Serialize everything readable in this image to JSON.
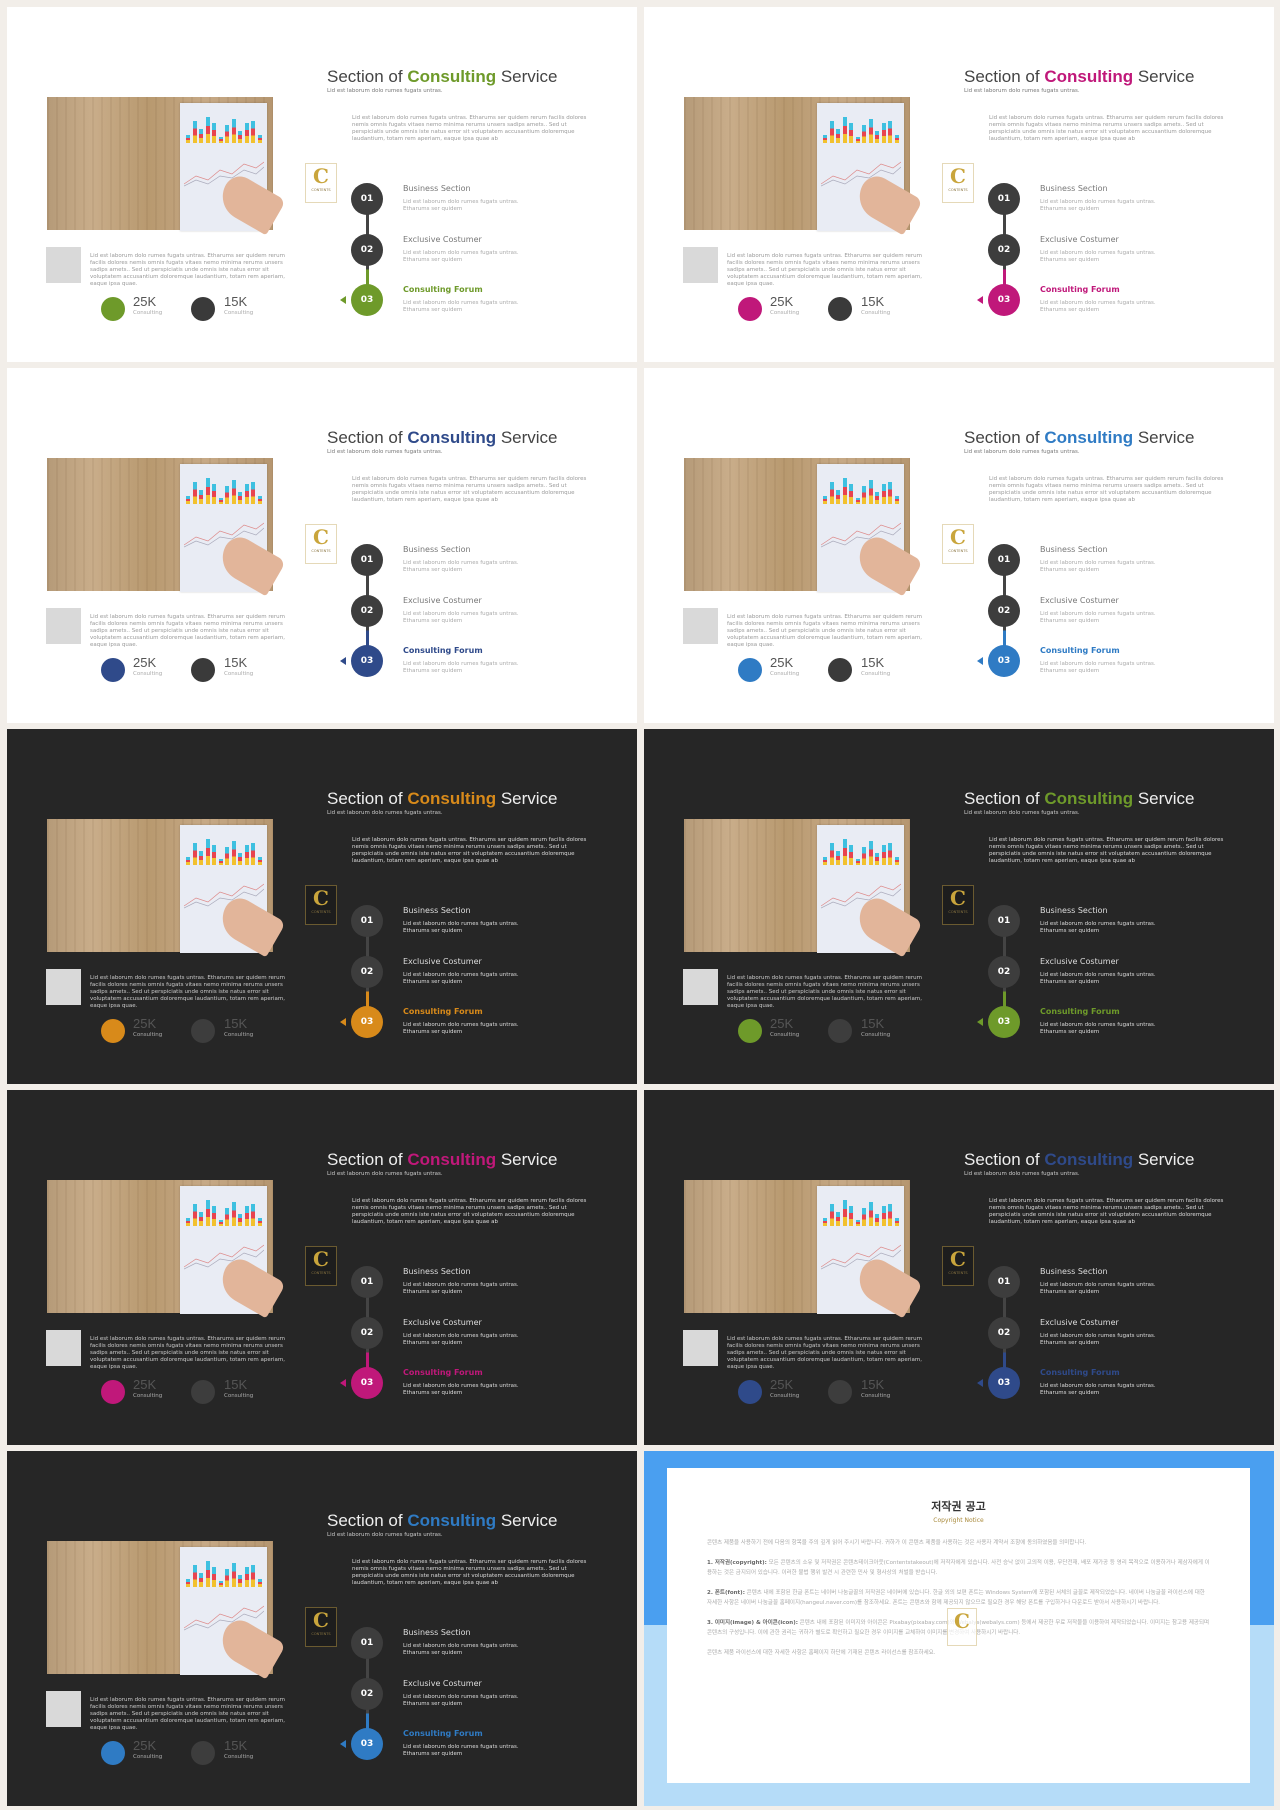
{
  "slide_template": {
    "title_pre": "Section of ",
    "title_accent": "Consulting",
    "title_post": " Service",
    "subtitle": "Lid est laborum dolo rumes fugats untras.",
    "paragraph": "Lid est laborum dolo rumes fugats untras. Etharums ser quidem rerum facilis dolores nemis omnis fugats vitaes nemo minima rerums unsers sadips amets.. Sed ut perspiciatis unde omnis iste natus error sit voluptatem accusantium doloremque laudantium, totam rem aperiam, eaque ipsa quae ab",
    "left_paragraph": "Lid est laborum dolo rumes fugats untras. Etharums ser quidem rerum facilis dolores nemis omnis fugats vitaes nemo minima rerums unsers sadips amets.. Sed ut perspiciatis unde omnis iste natus error sit voluptatem accusantium doloremque laudantium, totam rem aperiam, eaque ipsa quae.",
    "stats": [
      {
        "value": "25K",
        "label": "Consulting"
      },
      {
        "value": "15K",
        "label": "Consulting"
      }
    ],
    "logo_letter": "C",
    "logo_text": "CONTENTS",
    "steps": [
      {
        "num": "01",
        "title": "Business Section",
        "desc": "Lid est laborum dolo rumes fugats untras. Etharums ser quidem"
      },
      {
        "num": "02",
        "title": "Exclusive Costumer",
        "desc": "Lid est laborum dolo rumes fugats untras. Etharums ser quidem"
      },
      {
        "num": "03",
        "title": "Consulting Forum",
        "desc": "Lid est laborum dolo rumes fugats untras. Etharums ser quidem"
      }
    ],
    "active_step": 3
  },
  "slides": [
    {
      "theme": "light",
      "accent": "#6e9a2a"
    },
    {
      "theme": "light",
      "accent": "#c0187a"
    },
    {
      "theme": "light",
      "accent": "#2f4a8a"
    },
    {
      "theme": "light",
      "accent": "#2f7bc4"
    },
    {
      "theme": "dark",
      "accent": "#d88a1a"
    },
    {
      "theme": "dark",
      "accent": "#6e9a2a"
    },
    {
      "theme": "dark",
      "accent": "#c0187a"
    },
    {
      "theme": "dark",
      "accent": "#2f4a8a"
    },
    {
      "theme": "dark",
      "accent": "#2f7bc4"
    }
  ],
  "copyright": {
    "title": "저작권 공고",
    "subtitle": "Copyright Notice",
    "intro": "콘텐츠 제품을 사용하기 전에 다음의 항목을 주의 깊게 읽어 주시기 바랍니다. 귀하가 이 콘텐츠 제품을 사용하는 것은 사용자 계약서 조항에 동의하였음을 의미합니다.",
    "sections": [
      {
        "head": "1. 저작권(copyright):",
        "body": "모든 콘텐츠의 소유 및 저작권은 콘텐츠테이크아웃(Contentstakeout)에 저작자에게 있습니다. 사전 승낙 없이 고의적 이용, 무단전재, 배포 재가공 등 영리 목적으로 이용하거나 제삼자에게 이용하는 것은 금지되어 있습니다. 이러한 불법 행위 발견 시 관련한 민사 및 형사상의 처벌을 받습니다."
      },
      {
        "head": "2. 폰트(font):",
        "body": "콘텐츠 내에 포함된 한글 폰트는 네이버 나눔글꼴의 저작권은 네이버에 있습니다. 한글 외의 보편 폰트는 Windows System에 포함된 서체의 글꼴로 제작되었습니다. 네이버 나눔글꼴 라이선스에 대한 자세한 사항은 네이버 나눔글꼴 홈페이지(hangeul.naver.com)를 참조하세요. 폰트는 콘텐츠와 함께 제공되지 않으므로 필요한 경우 해당 폰트를 구입하거나 다운로드 받아서 사용하시기 바랍니다."
      },
      {
        "head": "3. 이미지(image) & 아이콘(icon):",
        "body": "콘텐츠 내에 포함된 이미지와 아이콘은 Pixabay(pixabay.com)와 Webalys(webalys.com) 등에서 제공한 무료 저작물을 이용하여 제작되었습니다. 이미지는 참고용 제공되며 콘텐츠의 구성입니다. 이에 관한 권리는 귀하가 별도로 확인하고 필요한 경우 이미지를 교체하여 이미지를 변경하여 사용하시기 바랍니다."
      }
    ],
    "footer": "콘텐츠 제품 라이선스에 대한 자세한 사항은 홈페이지 하단에 기재된 콘텐츠 라이선스를 참조하세요.",
    "logo_letter": "C"
  }
}
